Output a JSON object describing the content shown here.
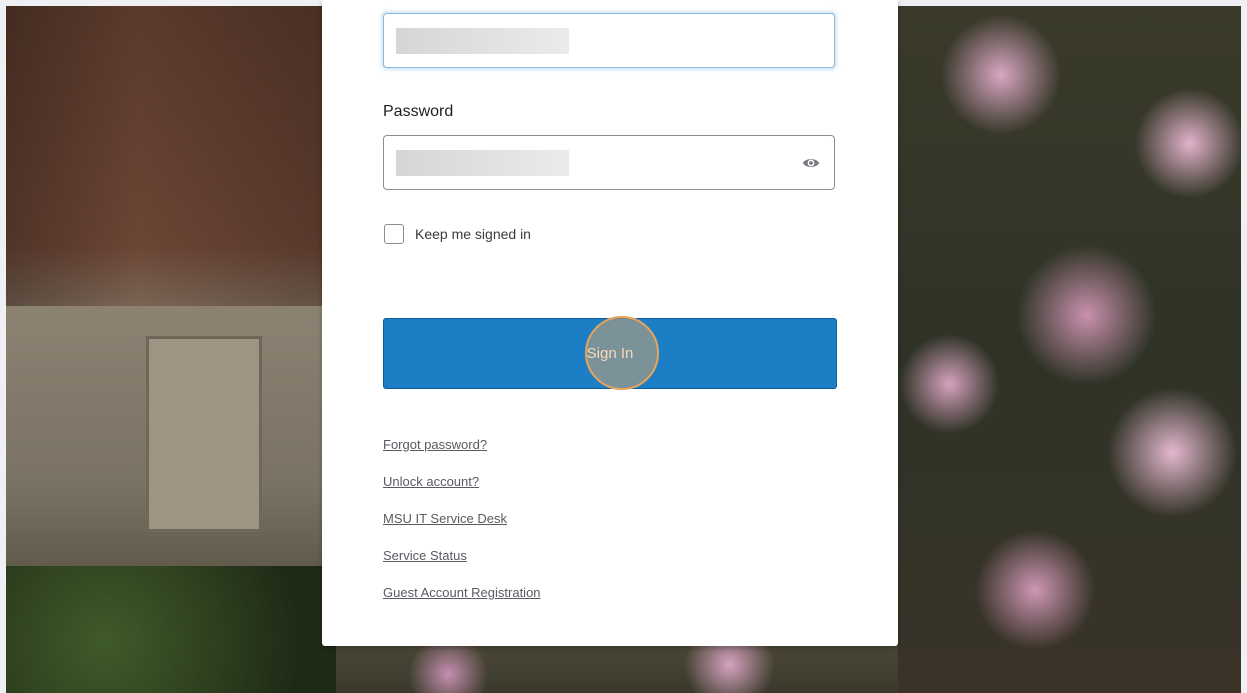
{
  "login": {
    "password_label": "Password",
    "keep_signed_in_label": "Keep me signed in",
    "sign_in_label": "Sign In",
    "links": [
      "Forgot password?",
      "Unlock account?",
      "MSU IT Service Desk",
      "Service Status",
      "Guest Account Registration"
    ]
  },
  "colors": {
    "primary_button": "#1c7ec4",
    "link": "#5a5a62",
    "click_indicator": "#e8a45a"
  },
  "icons": {
    "password_toggle": "eye-icon"
  }
}
